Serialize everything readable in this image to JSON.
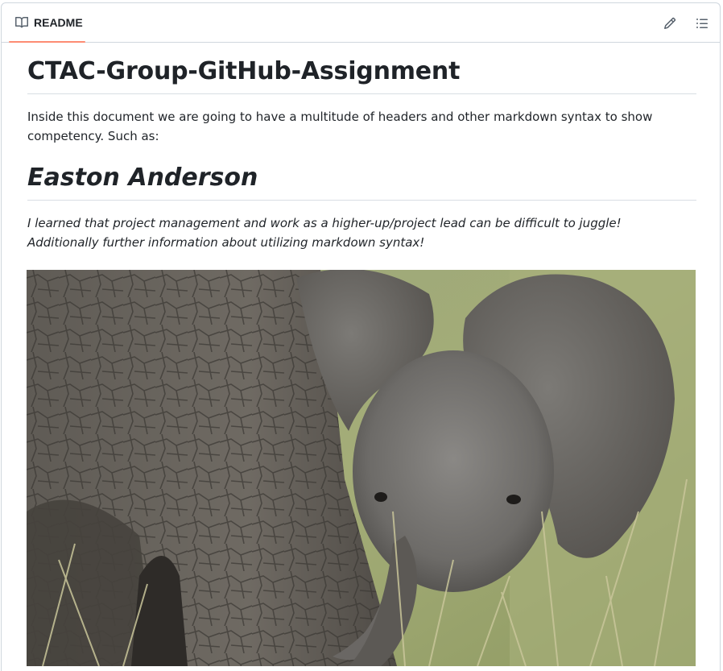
{
  "tabbar": {
    "tab_label": "README",
    "tab_icon": "book-icon",
    "edit_icon": "pencil-icon",
    "outline_icon": "list-unordered-icon",
    "accent_color": "#fd8c73"
  },
  "readme": {
    "title": "CTAC-Group-GitHub-Assignment",
    "intro": "Inside this document we are going to have a multitude of headers and other markdown syntax to show competency. Such as:",
    "section_heading": "Easton Anderson",
    "section_text": "I learned that project management and work as a higher-up/project lead can be difficult to juggle! Additionally further information about utilizing markdown syntax!"
  }
}
